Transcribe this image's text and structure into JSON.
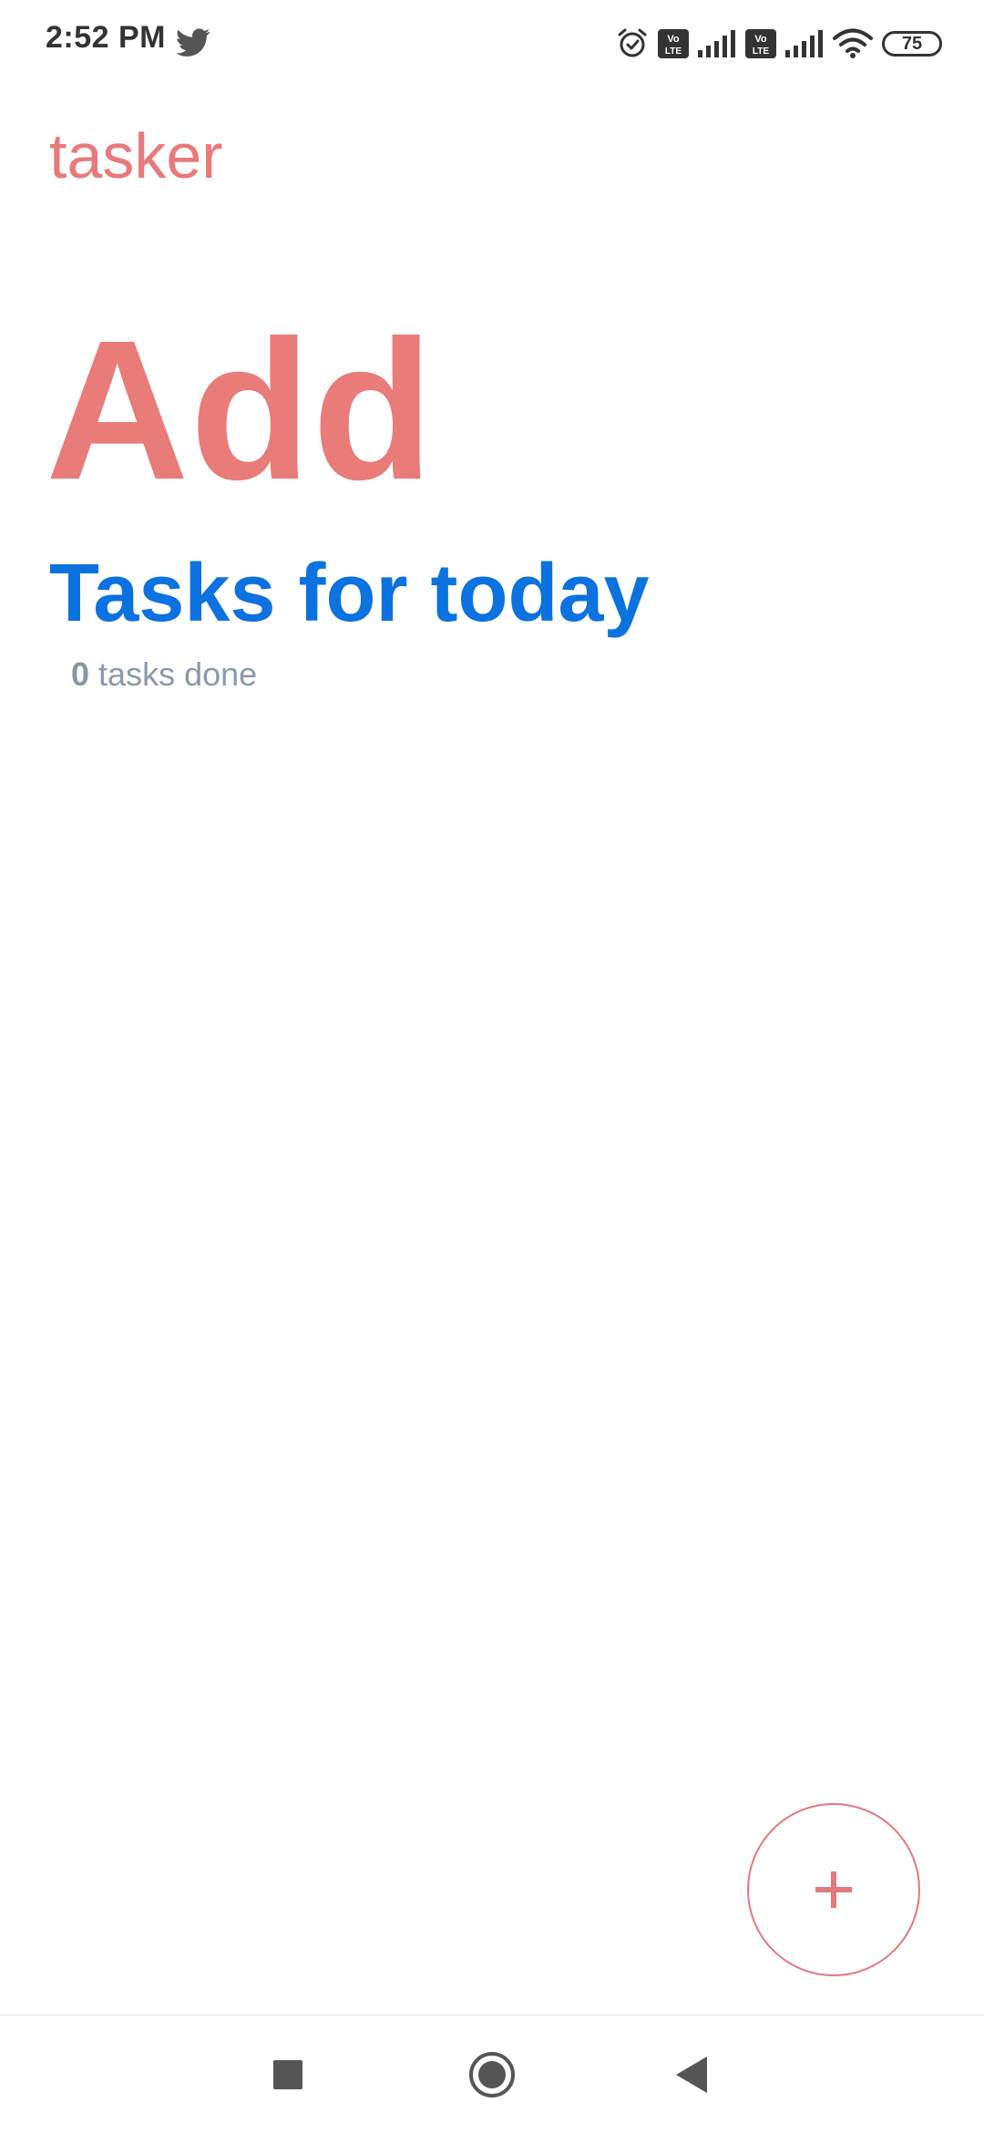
{
  "status_bar": {
    "time": "2:52 PM",
    "notification_icon": "twitter-icon",
    "battery_level": "75",
    "icons": [
      "alarm-icon",
      "volte-icon",
      "signal-icon",
      "volte-icon",
      "signal-icon",
      "wifi-icon",
      "battery-icon"
    ]
  },
  "app": {
    "title": "tasker"
  },
  "hero": {
    "title": "Add"
  },
  "tasks": {
    "heading": "Tasks for today",
    "done_count": "0",
    "done_label": "tasks done"
  },
  "fab": {
    "icon": "plus-icon"
  },
  "nav_bar": {
    "buttons": [
      "recents-button",
      "home-button",
      "back-button"
    ]
  },
  "colors": {
    "accent": "#e97b79",
    "heading_blue": "#0b72e0",
    "muted": "#8a9aad"
  }
}
